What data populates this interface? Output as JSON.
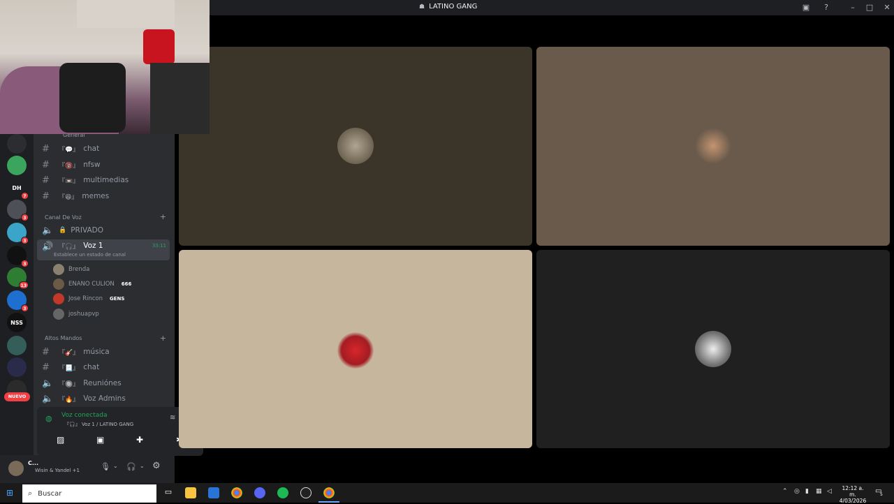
{
  "window": {
    "title": "LATINO GANG"
  },
  "channels": {
    "general_category": "General",
    "text": [
      {
        "deco": "『💬』",
        "name": "chat"
      },
      {
        "deco": "『🔞』",
        "name": "nfsw"
      },
      {
        "deco": "『📼』",
        "name": "multimedias"
      },
      {
        "deco": "『😆』",
        "name": "memes"
      }
    ],
    "voice_category": "Canal De Voz",
    "voice": [
      {
        "deco": "🔒",
        "name": "PRIVADO"
      },
      {
        "deco": "『🎧』",
        "name": "Voz 1",
        "timer": "33:11",
        "status": "Establece un estado de canal"
      }
    ],
    "members": [
      {
        "name": "Brenda",
        "tag": ""
      },
      {
        "name": "ENANO CULION",
        "tag": "666"
      },
      {
        "name": "Jose Rincon",
        "tag": "GENS"
      },
      {
        "name": "joshuapvp",
        "tag": ""
      }
    ],
    "admin_category": "Altos Mandos",
    "admin": [
      {
        "deco": "『🎸』",
        "name": "música"
      },
      {
        "deco": "『📃』",
        "name": "chat"
      },
      {
        "deco": "『🔘』",
        "name": "Reuniónes"
      },
      {
        "deco": "『🔥』",
        "name": "Voz Admins"
      }
    ]
  },
  "servers": [
    {
      "name": "server-1",
      "color": "#2b2d31",
      "badge": ""
    },
    {
      "name": "server-2",
      "color": "#3ba55d",
      "badge": ""
    },
    {
      "name": "server-dh",
      "label": "DH",
      "color": "#1e1f22",
      "badge": "7"
    },
    {
      "name": "server-4",
      "color": "#4e5058",
      "badge": "3"
    },
    {
      "name": "server-5",
      "color": "#3ba5c9",
      "badge": "3"
    },
    {
      "name": "server-6",
      "color": "#111",
      "badge": "3"
    },
    {
      "name": "server-7",
      "color": "#2e7d32",
      "badge": "13"
    },
    {
      "name": "server-8",
      "color": "#1f6fd1",
      "badge": "3"
    },
    {
      "name": "server-nss",
      "label": "NSS",
      "color": "#111",
      "badge": ""
    },
    {
      "name": "server-10",
      "color": "#355d5a",
      "badge": ""
    },
    {
      "name": "server-11",
      "color": "#2a2a4a",
      "badge": ""
    },
    {
      "name": "server-12",
      "color": "#2b2b2b",
      "badge": ""
    }
  ],
  "nuevo": "NUEVO",
  "voice_panel": {
    "status": "Voz conectada",
    "channel": "『🎧』 Voz 1 / LATINO GANG"
  },
  "user_panel": {
    "name": "C...",
    "activity": "Wisin & Yandel +1"
  },
  "taskbar": {
    "search": "Buscar",
    "time": "12:12 a. m.",
    "date": "4/03/2026",
    "notifications": "5"
  },
  "colors": {
    "tile1": "#3b3529",
    "tile2": "#6a5a4c",
    "tile3": "#c7b69e",
    "tile4": "#202020"
  }
}
